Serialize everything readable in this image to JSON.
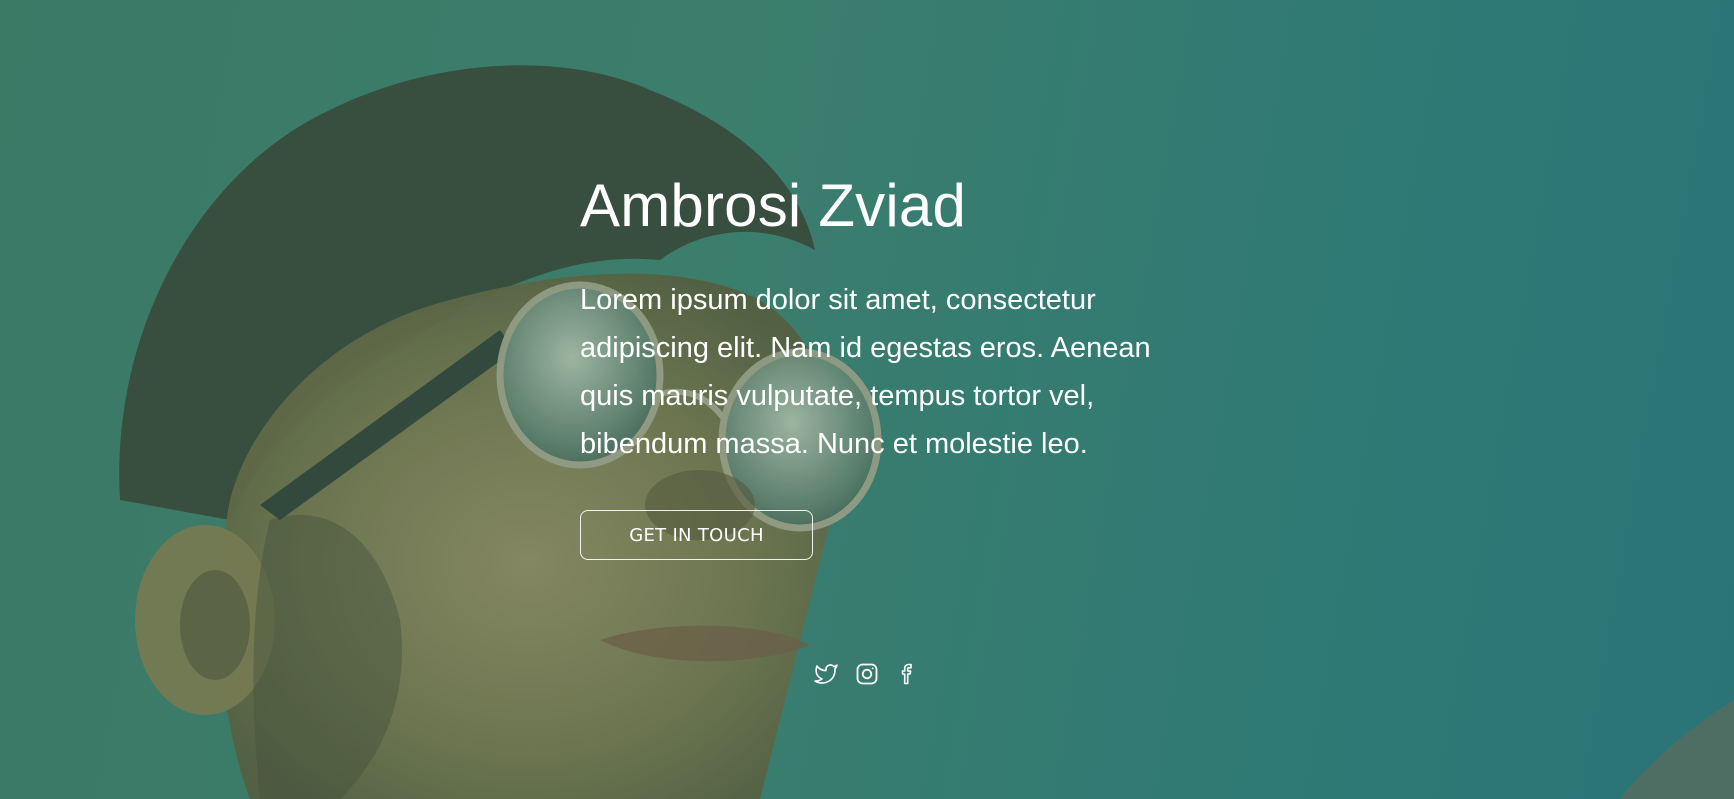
{
  "hero": {
    "name": "Ambrosi Zviad",
    "description": "Lorem ipsum dolor sit amet, consectetur adipiscing elit. Nam id egestas eros. Aenean quis mauris vulputate, tempus tortor vel, bibendum massa. Nunc et molestie leo.",
    "cta_label": "GET IN TOUCH",
    "background_tint": "#3a7d6f",
    "text_color": "#ffffff"
  },
  "socials": [
    {
      "icon": "twitter-icon"
    },
    {
      "icon": "instagram-icon"
    },
    {
      "icon": "facebook-icon"
    }
  ]
}
